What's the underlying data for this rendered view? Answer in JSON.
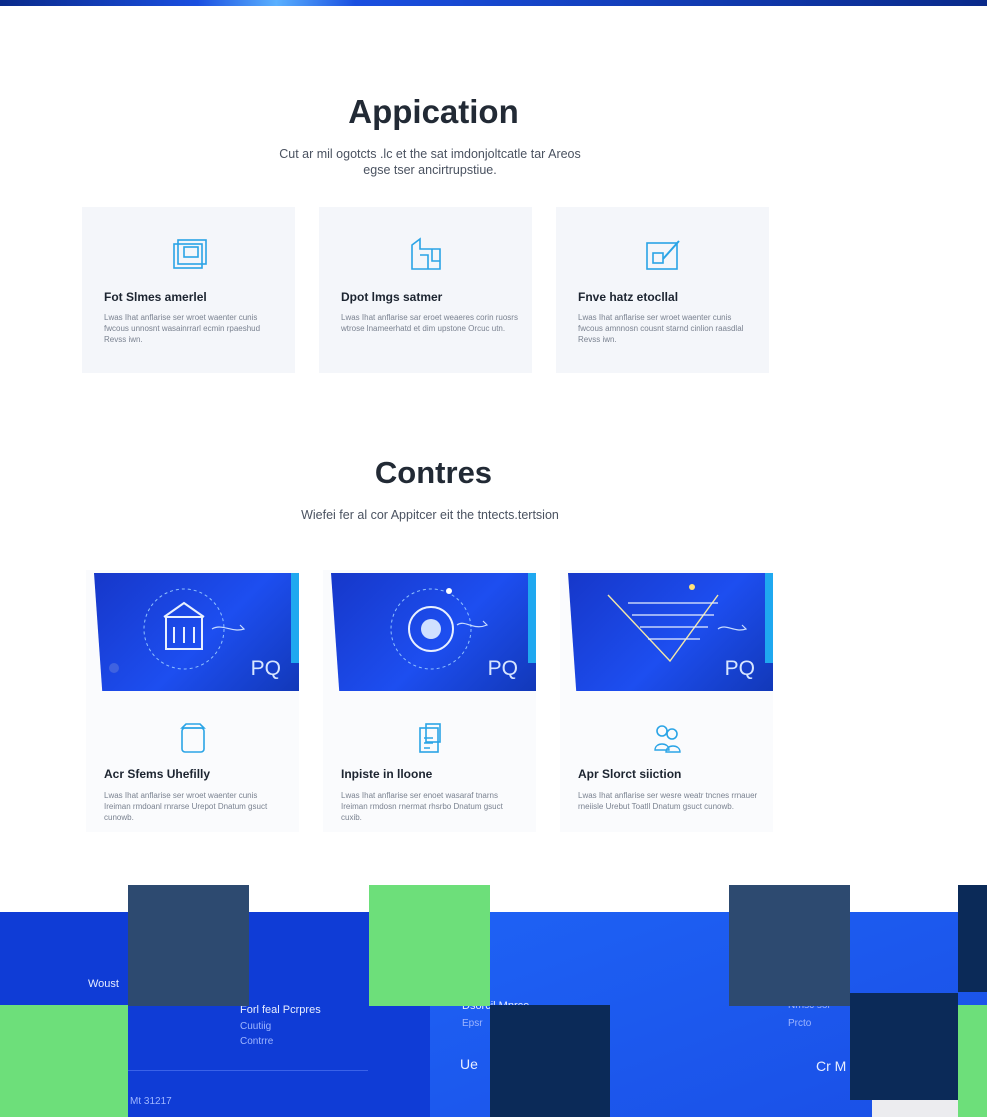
{
  "application": {
    "title": "Appication",
    "subtitle_line1": "Cut ar mil ogotcts .lc et the sat imdonjoltcatle tar Areos",
    "subtitle_line2": "egse tser ancirtrupstiue.",
    "cards": [
      {
        "title": "Fot Slmes amerlel",
        "body": "Lwas Ihat anflarise ser wroet waenter cunis fwcous unnosnt wasainrrarl ecmin rpaeshud Revss iwn.",
        "icon": "blueprint-icon"
      },
      {
        "title": "Dpot lmgs satmer",
        "body": "Lwas Ihat anflarise sar eroet weaeres corin ruosrs wtrose lnameerhatd et dim upstone Orcuc utn.",
        "icon": "floorplan-icon"
      },
      {
        "title": "Fnve hatz etocllal",
        "body": "Lwas Ihat anflarise ser wroet waenter cunis fwcous amnnosn cousnt starnd cinlion raasdlal Revss iwn.",
        "icon": "document-edit-icon"
      }
    ]
  },
  "contres": {
    "title": "Contres",
    "subtitle": "Wiefei fer al cor Appitcer eit the tntects.tertsion",
    "cards": [
      {
        "title": "Acr Sfems Uhefilly",
        "body": "Lwas Ihat anflarise ser wroet waenter cunis Ireiman rmdoanl rnrarse Urepot Dnatum gsuct cunowb.",
        "icon": "box-icon",
        "banner": "PQ"
      },
      {
        "title": "Inpiste in lloone",
        "body": "Lwas Ihat anflarise ser enoet wasaraf tnarns Ireiman rmdosn rnermat rhsrbo Dnatum gsuct cuxib.",
        "icon": "report-icon",
        "banner": "PQ"
      },
      {
        "title": "Apr Slorct siiction",
        "body": "Lwas Ihat anflarise ser wesre weatr tncnes rrnauer rneiisle Urebut Toatll Dnatum gsuct cunowb.",
        "icon": "people-icon",
        "banner": "PQ"
      }
    ]
  },
  "footer": {
    "col1": "Woust",
    "col2_title": "Forl feal Pcrpres",
    "col2_items": [
      "Cuutiig",
      "Contrre"
    ],
    "copyright": "Mt 31217",
    "col3_title": "Dsorcil Mprce",
    "col3_sub": "Epsr",
    "col3_link": "Ue",
    "col4_title": "Nrrisc sor",
    "col4_sub": "Prcto",
    "col4_link": "Cr M"
  },
  "colors": {
    "footer_blue": "#0f3cd6",
    "square_slate": "#2d4a70",
    "square_green": "#6ddf7a",
    "square_navy": "#0b2a58"
  }
}
